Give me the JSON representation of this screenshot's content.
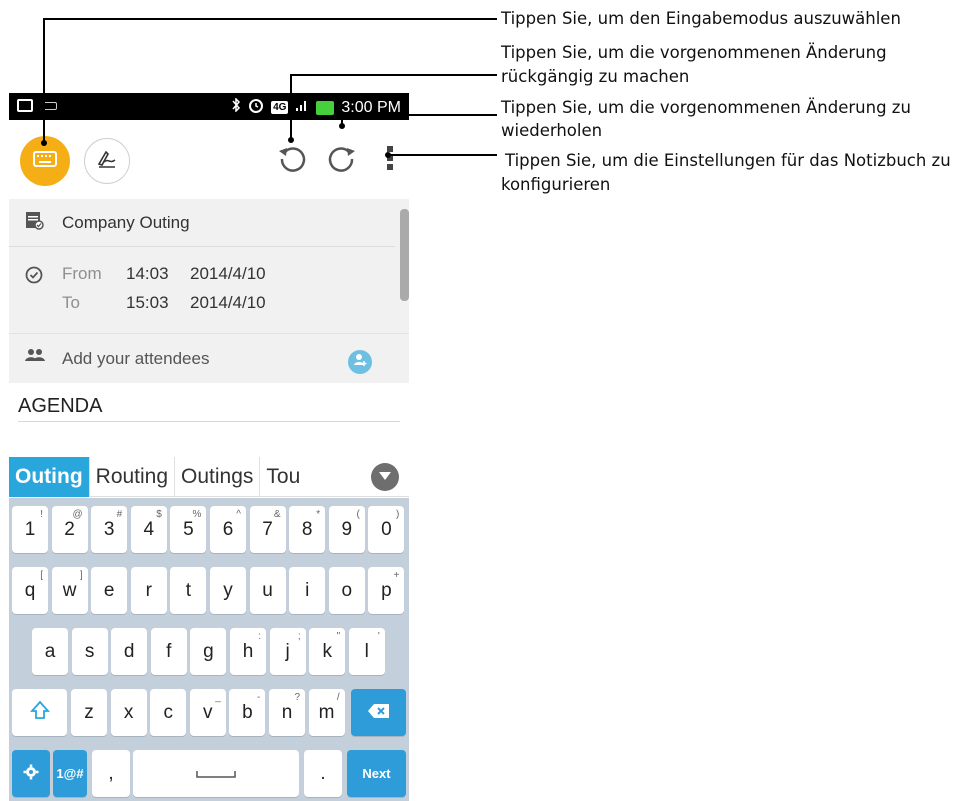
{
  "callouts": {
    "input_mode": "Tippen Sie, um den Eingabemodus auszuwählen",
    "undo_line1": "Tippen Sie, um die vorgenommenen Änderung",
    "undo_line2": "rückgängig zu machen",
    "redo_line1": "Tippen Sie, um die vorgenommenen Änderung zu",
    "redo_line2": "wiederholen",
    "settings_line1": "Tippen Sie, um die Einstellungen für das Notizbuch zu",
    "settings_line2": "konfigurieren"
  },
  "statusbar": {
    "network": "4G",
    "time": "3:00 PM"
  },
  "event": {
    "title": "Company Outing",
    "from_label": "From",
    "from_time": "14:03",
    "from_date": "2014/4/10",
    "to_label": "To",
    "to_time": "15:03",
    "to_date": "2014/4/10",
    "attendees_placeholder": "Add your attendees"
  },
  "note": {
    "text": "AGENDA"
  },
  "suggestions": [
    "Outing",
    "Routing",
    "Outings",
    "Tou"
  ],
  "keyboard": {
    "row1": [
      [
        "1",
        "!"
      ],
      [
        "2",
        "@"
      ],
      [
        "3",
        "#"
      ],
      [
        "4",
        "$"
      ],
      [
        "5",
        "%"
      ],
      [
        "6",
        "^"
      ],
      [
        "7",
        "&"
      ],
      [
        "8",
        "*"
      ],
      [
        "9",
        "("
      ],
      [
        "0",
        ")"
      ]
    ],
    "row2": [
      [
        "q",
        "["
      ],
      [
        "w",
        "]"
      ],
      [
        "e",
        ""
      ],
      [
        "r",
        ""
      ],
      [
        "t",
        ""
      ],
      [
        "y",
        ""
      ],
      [
        "u",
        ""
      ],
      [
        "i",
        ""
      ],
      [
        "o",
        ""
      ],
      [
        "p",
        "+"
      ]
    ],
    "row3": [
      [
        "a",
        ""
      ],
      [
        "s",
        ""
      ],
      [
        "d",
        ""
      ],
      [
        "f",
        ""
      ],
      [
        "g",
        ""
      ],
      [
        "h",
        ":"
      ],
      [
        "j",
        ";"
      ],
      [
        "k",
        "\""
      ],
      [
        "l",
        "'"
      ]
    ],
    "row4": [
      [
        "z",
        ""
      ],
      [
        "x",
        ""
      ],
      [
        "c",
        ""
      ],
      [
        "v",
        "_"
      ],
      [
        "b",
        "-"
      ],
      [
        "n",
        "?"
      ],
      [
        "m",
        "/"
      ]
    ],
    "symbols_label": "1@#",
    "comma": ",",
    "period": ".",
    "next_label": "Next"
  },
  "colors": {
    "accent_orange": "#f5ae16",
    "accent_blue": "#29a7dd",
    "keyboard_bg": "#c3d0db"
  }
}
